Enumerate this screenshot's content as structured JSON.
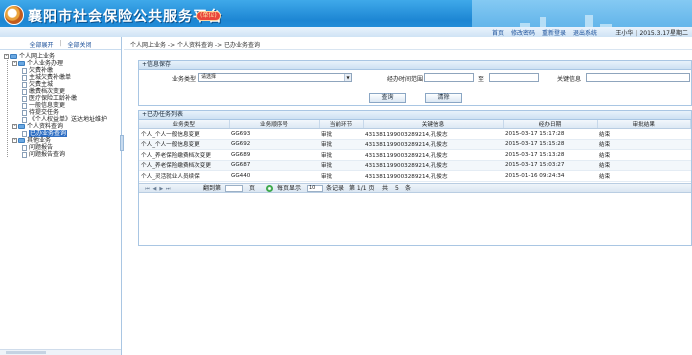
{
  "header": {
    "site_title": "襄阳市社会保险公共服务平台",
    "badge": "(单位)",
    "links": [
      "首页",
      "修改密码",
      "重新登录",
      "退出系统"
    ],
    "user": "王小华",
    "date": "2015.3.17星期二"
  },
  "sidebar": {
    "expand_all": "全部展开",
    "collapse_all": "全部关闭",
    "tree": [
      {
        "label": "个人网上业务",
        "level": 1
      },
      {
        "label": "个人业务办理",
        "level": 2
      },
      {
        "label": "欠费补缴",
        "level": 3
      },
      {
        "label": "主城欠费补缴单",
        "level": 3
      },
      {
        "label": "欠费主城",
        "level": 3
      },
      {
        "label": "缴费档次变更",
        "level": 3
      },
      {
        "label": "医疗保险工龄补缴",
        "level": 3
      },
      {
        "label": "一般信息变更",
        "level": 3
      },
      {
        "label": "待提交任务",
        "level": 3
      },
      {
        "label": "《个人权益单》送达地址维护",
        "level": 3
      },
      {
        "label": "个人资料查询",
        "level": 2
      },
      {
        "label": "已办业务查询",
        "level": 3,
        "selected": true
      },
      {
        "label": "其他业务",
        "level": 2
      },
      {
        "label": "问题报告",
        "level": 3
      },
      {
        "label": "问题报告查询",
        "level": 3
      }
    ]
  },
  "breadcrumb": "个人网上业务 -> 个人资料查询 -> 已办业务查询",
  "query": {
    "title": "+信息保存",
    "type_label": "业务类型",
    "type_value": "请选择",
    "time_label": "经办时间范围",
    "to_label": "至",
    "key_label": "关键信息",
    "search_button": "查询",
    "clear_button": "清除"
  },
  "results": {
    "title": "+已办任务列表",
    "columns": [
      "业务类型",
      "业务顺序号",
      "当前环节",
      "关键信息",
      "经办日期",
      "审批结果"
    ],
    "rows": [
      [
        "个人_个人一般信息变更",
        "GG693",
        "审批",
        "431381199003289214,孔俊志",
        "2015-03-17 15:17:28",
        "结束"
      ],
      [
        "个人_个人一般信息变更",
        "GG692",
        "审批",
        "431381199003289214,孔俊志",
        "2015-03-17 15:15:28",
        "结束"
      ],
      [
        "个人_养老保险缴费档次变更",
        "GG689",
        "审批",
        "431381199003289214,孔俊志",
        "2015-03-17 15:13:28",
        "结束"
      ],
      [
        "个人_养老保险缴费档次变更",
        "GG687",
        "审批",
        "431381199003289214,孔俊志",
        "2015-03-17 15:03:27",
        "结束"
      ],
      [
        "个人_灵活就业人员续保",
        "GG440",
        "审批",
        "431381199003289214,孔俊志",
        "2015-01-16 09:24:34",
        "结束"
      ]
    ],
    "pager": {
      "goto_label": "翻到第",
      "page_unit": "页",
      "per_page_label": "每页显示",
      "per_page": "10",
      "records_label": "条记录",
      "page_info": "第 1/1 页",
      "total_prefix": "共",
      "total": "5",
      "total_suffix": "条"
    }
  }
}
